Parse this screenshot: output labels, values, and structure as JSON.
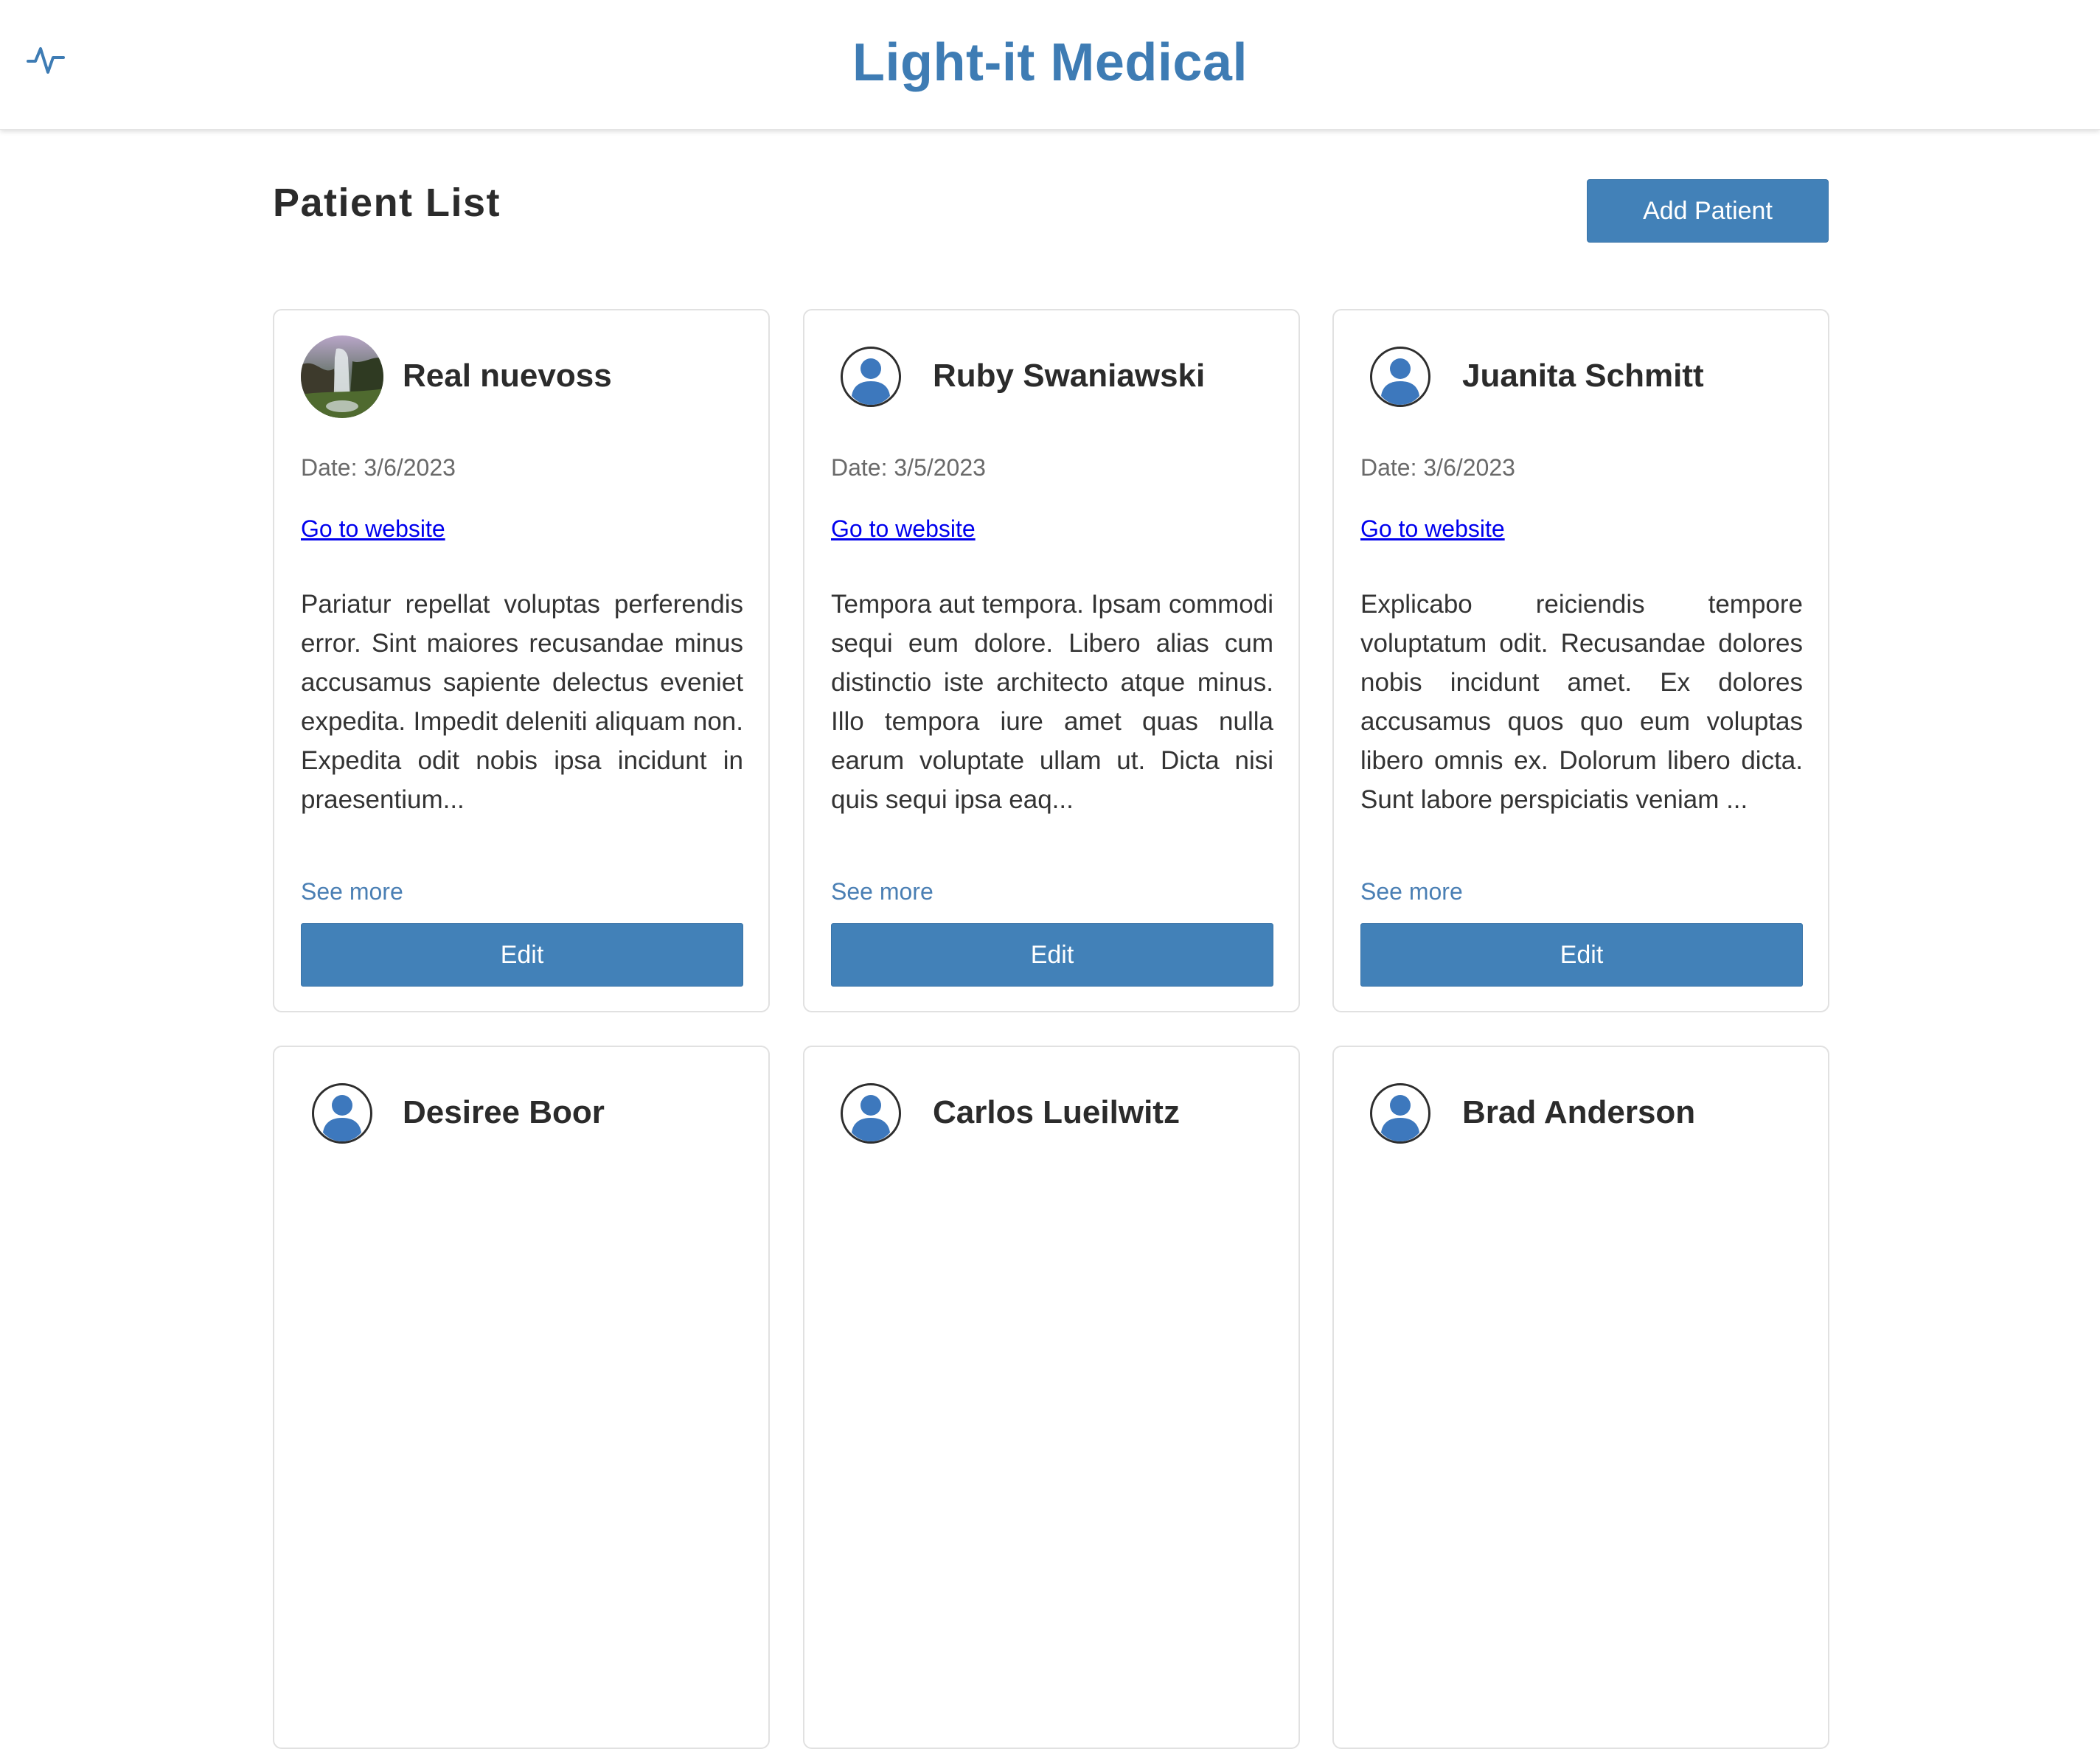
{
  "header": {
    "title": "Light-it Medical",
    "logo_icon": "activity-pulse-icon",
    "accent_color": "#3e7cb4"
  },
  "page": {
    "title": "Patient List",
    "add_button_label": "Add Patient"
  },
  "patients": [
    {
      "name": "Real nuevoss",
      "avatar": "landscape-photo",
      "date": "Date: 3/6/2023",
      "link_label": "Go to website",
      "description": "Pariatur repellat voluptas perferendis error. Sint maiores recusandae minus accusamus sapiente delectus eveniet expedita. Impedit deleniti aliquam non. Expedita odit nobis ipsa incidunt in praesentium...",
      "see_more_label": "See more",
      "edit_label": "Edit"
    },
    {
      "name": "Ruby Swaniawski",
      "avatar": "user-avatar-icon",
      "date": "Date: 3/5/2023",
      "link_label": "Go to website",
      "description": "Tempora aut tempora. Ipsam commodi sequi eum dolore. Libero alias cum distinctio iste architecto atque minus. Illo tempora iure amet quas nulla earum voluptate ullam ut. Dicta nisi quis sequi ipsa eaq...",
      "see_more_label": "See more",
      "edit_label": "Edit"
    },
    {
      "name": "Juanita Schmitt",
      "avatar": "user-avatar-icon",
      "date": "Date: 3/6/2023",
      "link_label": "Go to website",
      "description": "Explicabo reiciendis tempore voluptatum odit. Recusandae dolores nobis incidunt amet. Ex dolores accusamus quos quo eum voluptas libero omnis ex. Dolorum libero dicta. Sunt labore perspiciatis veniam ...",
      "see_more_label": "See more",
      "edit_label": "Edit"
    },
    {
      "name": "Desiree Boor",
      "avatar": "user-avatar-icon"
    },
    {
      "name": "Carlos Lueilwitz",
      "avatar": "user-avatar-icon"
    },
    {
      "name": "Brad Anderson",
      "avatar": "user-avatar-icon"
    }
  ],
  "colors": {
    "button_bg": "#4281b8",
    "link": "#0000ee",
    "see_more": "#4a7fb4",
    "avatar_blue": "#3d78bd"
  }
}
